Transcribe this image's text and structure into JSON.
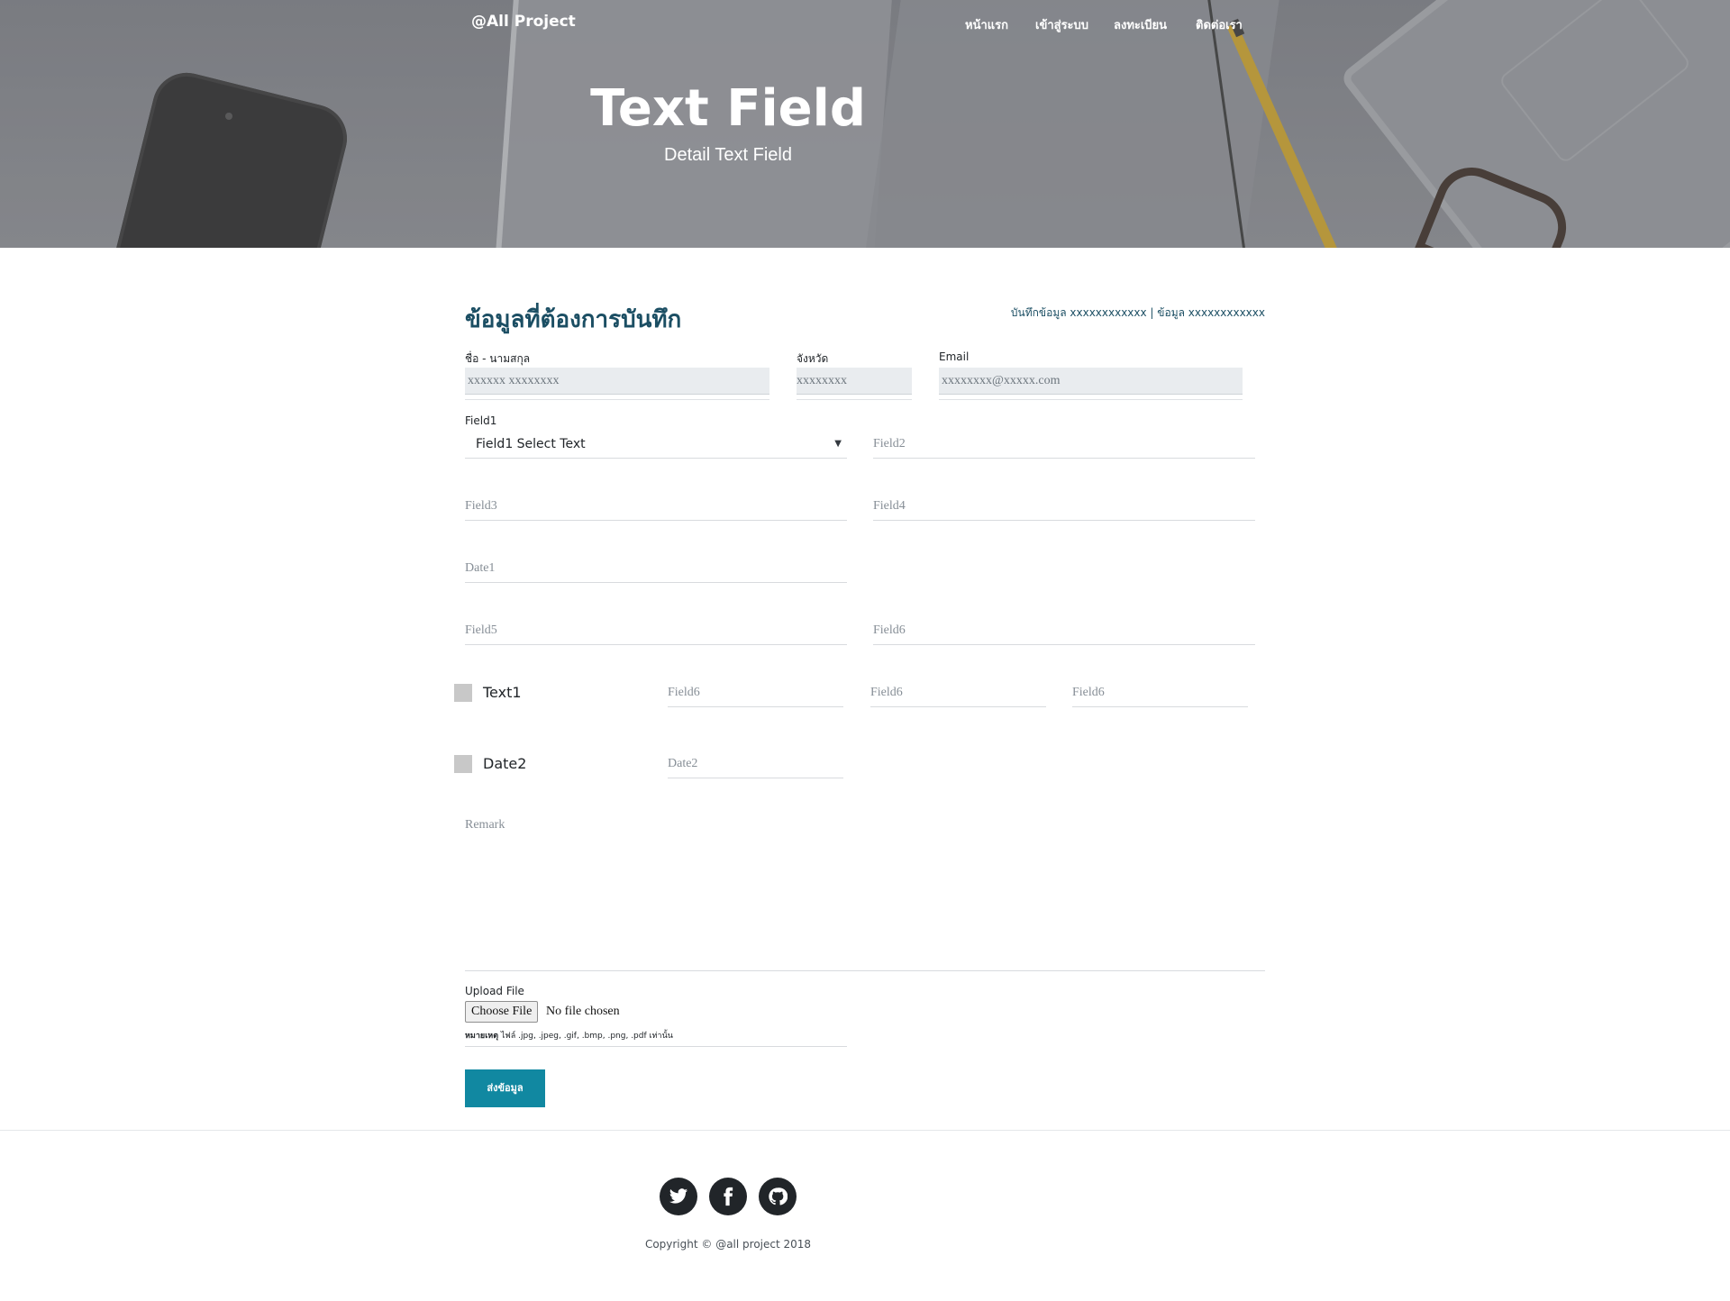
{
  "nav": {
    "brand": "@All Project",
    "items": [
      "หน้าแรก",
      "เข้าสู่ระบบ",
      "ลงทะเบียน",
      "ติดต่อเรา"
    ]
  },
  "hero": {
    "title": "Text Field",
    "subtitle": "Detail Text Field"
  },
  "form": {
    "heading": "ข้อมูลที่ต้องการบันทึก",
    "meta": "บันทึกข้อมูล xxxxxxxxxxxx | ข้อมูล xxxxxxxxxxxx",
    "name_label": "ชื่อ - นามสกุล",
    "name_value": "xxxxxx xxxxxxxx",
    "province_label": "จังหวัด",
    "province_value": "xxxxxxxx",
    "email_label": "Email",
    "email_value": "xxxxxxxx@xxxxx.com",
    "field1_label": "Field1",
    "field1_selected": "Field1 Select Text",
    "field2_placeholder": "Field2",
    "field3_placeholder": "Field3",
    "field4_placeholder": "Field4",
    "date1_placeholder": "Date1",
    "field5_placeholder": "Field5",
    "field6_placeholder": "Field6",
    "text1_label": "Text1",
    "text1_fields": [
      "Field6",
      "Field6",
      "Field6"
    ],
    "date2_label": "Date2",
    "date2_placeholder": "Date2",
    "remark_placeholder": "Remark",
    "upload_label": "Upload File",
    "choose_file": "Choose File",
    "file_status": "No file chosen",
    "file_note_bold": "หมายเหตุ",
    "file_note": " ไฟล์ .jpg, .jpeg, .gif, .bmp, .png, .pdf เท่านั้น",
    "submit": "ส่งข้อมูล"
  },
  "footer": {
    "social_icons": [
      "twitter-icon",
      "facebook-icon",
      "github-icon"
    ],
    "copyright": "Copyright © @all project 2018"
  }
}
